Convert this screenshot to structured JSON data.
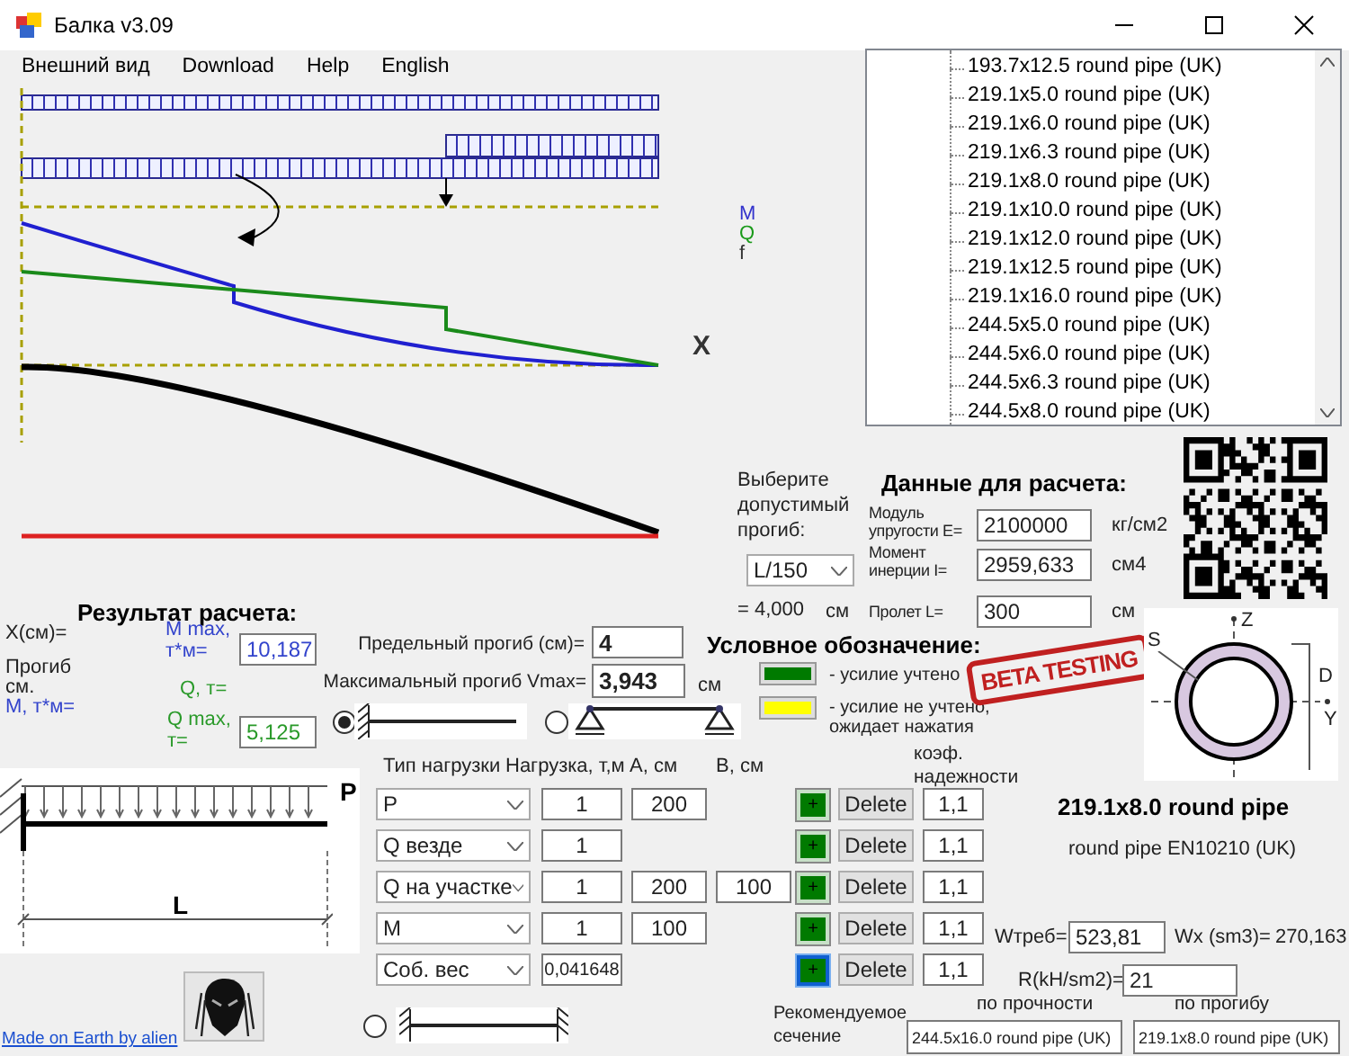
{
  "window": {
    "title": "Балка v3.09"
  },
  "menu": [
    "Внешний вид",
    "Download",
    "Help",
    "English"
  ],
  "diagram": {
    "legend": [
      {
        "label": "M",
        "color": "#3333cc"
      },
      {
        "label": "Q",
        "color": "#1a9a1a"
      },
      {
        "label": "f",
        "color": "#333333"
      }
    ],
    "axis_label": "X"
  },
  "section_list": {
    "items": [
      "193.7x12.5 round pipe (UK)",
      "219.1x5.0 round pipe (UK)",
      "219.1x6.0 round pipe (UK)",
      "219.1x6.3 round pipe (UK)",
      "219.1x8.0 round pipe (UK)",
      "219.1x10.0 round pipe (UK)",
      "219.1x12.0 round pipe (UK)",
      "219.1x12.5 round pipe (UK)",
      "219.1x16.0 round pipe (UK)",
      "244.5x5.0 round pipe (UK)",
      "244.5x6.0 round pipe (UK)",
      "244.5x6.3 round pipe (UK)",
      "244.5x8.0 round pipe (UK)"
    ]
  },
  "allowable_deflection": {
    "label": "Выберите допустимый прогиб:",
    "value": "L/150",
    "result": "=  4,000",
    "unit": "см"
  },
  "input_data": {
    "title": "Данные для расчета:",
    "fields": [
      {
        "label": "Модуль упругости E=",
        "value": "2100000",
        "unit": "кг/см2"
      },
      {
        "label": "Момент инерции I=",
        "value": "2959,633",
        "unit": "см4"
      },
      {
        "label": "Пролет L=",
        "value": "300",
        "unit": "см"
      }
    ]
  },
  "results": {
    "title": "Результат расчета:",
    "x_label": "X(см)=",
    "deflection_label": "Прогиб см.",
    "moment_label": "M, т*м=",
    "m_max": {
      "label": "M max, т*м=",
      "value": "10,187"
    },
    "q_label": "Q, т=",
    "q_max": {
      "label": "Q max, т=",
      "value": "5,125"
    }
  },
  "limit_deflection": {
    "label": "Предельный прогиб (см)=",
    "value": "4"
  },
  "max_deflection": {
    "label": "Максимальный прогиб Vmax=",
    "value": "3,943",
    "unit": "см"
  },
  "legend": {
    "title": "Условное обозначение:",
    "items": [
      {
        "color": "#007a00",
        "text": "- усилие учтено"
      },
      {
        "color": "#ffff00",
        "text": "- усилие не учтено, ожидает нажатия"
      }
    ]
  },
  "stamp": "BETA TESTING",
  "supports": [
    {
      "kind": "cantilever",
      "selected": true
    },
    {
      "kind": "simple",
      "selected": false
    },
    {
      "kind": "fixed",
      "selected": false
    }
  ],
  "load_scheme": {
    "force_label": "P",
    "span_label": "L"
  },
  "section_drawing": {
    "labels": [
      "S",
      "Z",
      "D",
      "Y"
    ]
  },
  "loads": {
    "columns": [
      "Тип нагрузки",
      "Нагрузка, т,м",
      "А, см",
      "В, см",
      "коэф. надежности"
    ],
    "rows": [
      {
        "type": "P",
        "value": "1",
        "a": "200",
        "add": "+",
        "delete": "Delete",
        "factor": "1,1",
        "focused": false
      },
      {
        "type": "Q везде",
        "value": "1",
        "add": "+",
        "delete": "Delete",
        "factor": "1,1",
        "focused": false
      },
      {
        "type": "Q на участке",
        "value": "1",
        "a": "200",
        "b": "100",
        "add": "+",
        "delete": "Delete",
        "factor": "1,1",
        "focused": false
      },
      {
        "type": "M",
        "value": "1",
        "a": "100",
        "add": "+",
        "delete": "Delete",
        "factor": "1,1",
        "focused": false
      },
      {
        "type": "Соб. вес",
        "value": "0,041648",
        "add": "+",
        "delete": "Delete",
        "factor": "1,1",
        "focused": true
      }
    ]
  },
  "section": {
    "name": "219.1x8.0 round pipe",
    "standard": "round pipe EN10210 (UK)",
    "w_req": {
      "label": "Wтреб=",
      "value": "523,81"
    },
    "wx": {
      "label": "Wx (sm3)=",
      "value": "270,163"
    },
    "r": {
      "label": "R(kH/sm2)=",
      "value": "21"
    }
  },
  "recommended": {
    "label": "Рекомендуемое сечение",
    "columns": [
      {
        "header": "по прочности",
        "value": "244.5x16.0 round pipe (UK)"
      },
      {
        "header": "по прогибу",
        "value": "219.1x8.0 round pipe (UK)"
      }
    ]
  },
  "footer": {
    "link": "Made on Earth by alien"
  }
}
